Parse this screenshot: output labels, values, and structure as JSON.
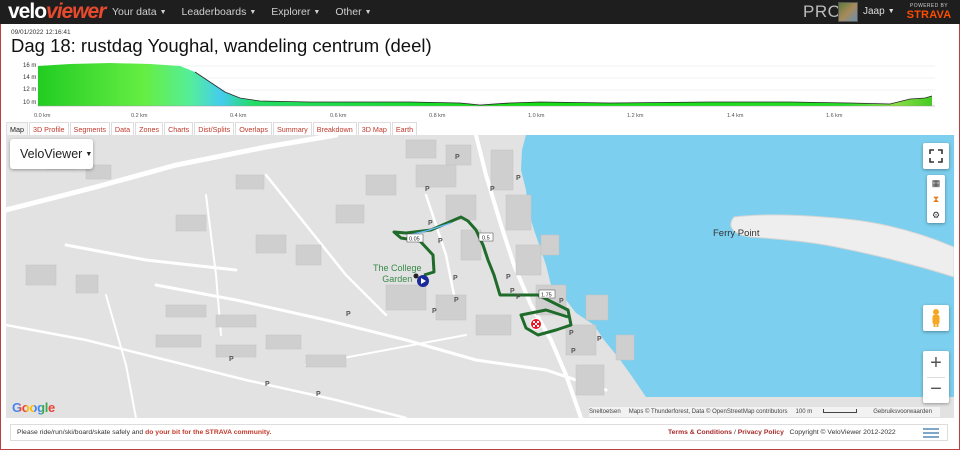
{
  "app": {
    "logo_a": "velo",
    "logo_b": "viewer"
  },
  "nav": {
    "items": [
      {
        "label": "Your data"
      },
      {
        "label": "Leaderboards"
      },
      {
        "label": "Explorer"
      },
      {
        "label": "Other"
      }
    ],
    "pro_label": "PRO",
    "user": "Jaap",
    "powered_by": "POWERED BY",
    "strava": "STRAVA"
  },
  "activity": {
    "timestamp": "09/01/2022 12:16:41",
    "title": "Dag 18: rustdag Youghal, wandeling centrum (deel)"
  },
  "elevation": {
    "y_labels": [
      "16 m",
      "14 m",
      "12 m",
      "10 m"
    ],
    "x_labels": [
      "0.0 km",
      "0.2 km",
      "0.4 km",
      "0.6 km",
      "0.8 km",
      "1.0 km",
      "1.2 km",
      "1.4 km",
      "1.6 km"
    ]
  },
  "tabs": [
    {
      "label": "Map",
      "active": true
    },
    {
      "label": "3D Profile"
    },
    {
      "label": "Segments"
    },
    {
      "label": "Data"
    },
    {
      "label": "Zones"
    },
    {
      "label": "Charts"
    },
    {
      "label": "Dist/Splits"
    },
    {
      "label": "Overlaps"
    },
    {
      "label": "Summary"
    },
    {
      "label": "Breakdown"
    },
    {
      "label": "3D Map"
    },
    {
      "label": "Earth"
    }
  ],
  "map": {
    "layer_selector": "VeloViewer",
    "places": {
      "ferry_point": "Ferry Point",
      "garden_line1": "The College",
      "garden_line2": "Garden"
    },
    "markers": {
      "m1": "0.05",
      "m2": "0.5",
      "m3": "1.75"
    },
    "google": "Google",
    "attribution": {
      "shortcuts": "Sneltoetsen",
      "data": "Maps © Thunderforest, Data © OpenStreetMap contributors",
      "scale": "100 m",
      "terms": "Gebruiksvoorwaarden"
    },
    "colors": {
      "water": "#7ccfee",
      "land": "#e2e2e2",
      "route": "#1f6b2a"
    }
  },
  "footer": {
    "left_text": "Please ride/run/ski/board/skate safely and",
    "left_link": "do your bit for the STRAVA community.",
    "terms": "Terms & Conditions",
    "slash": "/",
    "privacy": "Privacy Policy",
    "copyright": "Copyright © VeloViewer 2012-2022"
  }
}
